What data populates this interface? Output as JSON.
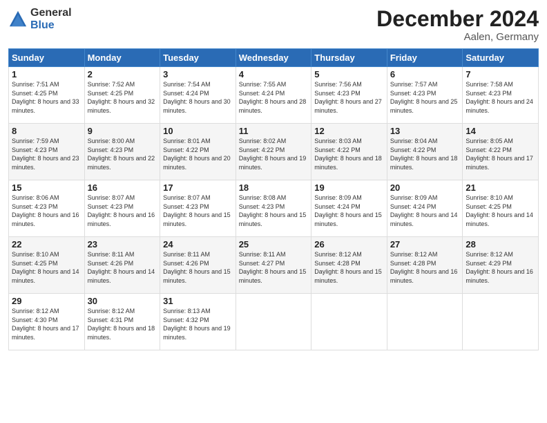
{
  "header": {
    "logo_general": "General",
    "logo_blue": "Blue",
    "month_title": "December 2024",
    "location": "Aalen, Germany"
  },
  "days_of_week": [
    "Sunday",
    "Monday",
    "Tuesday",
    "Wednesday",
    "Thursday",
    "Friday",
    "Saturday"
  ],
  "weeks": [
    [
      {
        "day": "1",
        "sunrise": "Sunrise: 7:51 AM",
        "sunset": "Sunset: 4:25 PM",
        "daylight": "Daylight: 8 hours and 33 minutes."
      },
      {
        "day": "2",
        "sunrise": "Sunrise: 7:52 AM",
        "sunset": "Sunset: 4:25 PM",
        "daylight": "Daylight: 8 hours and 32 minutes."
      },
      {
        "day": "3",
        "sunrise": "Sunrise: 7:54 AM",
        "sunset": "Sunset: 4:24 PM",
        "daylight": "Daylight: 8 hours and 30 minutes."
      },
      {
        "day": "4",
        "sunrise": "Sunrise: 7:55 AM",
        "sunset": "Sunset: 4:24 PM",
        "daylight": "Daylight: 8 hours and 28 minutes."
      },
      {
        "day": "5",
        "sunrise": "Sunrise: 7:56 AM",
        "sunset": "Sunset: 4:23 PM",
        "daylight": "Daylight: 8 hours and 27 minutes."
      },
      {
        "day": "6",
        "sunrise": "Sunrise: 7:57 AM",
        "sunset": "Sunset: 4:23 PM",
        "daylight": "Daylight: 8 hours and 25 minutes."
      },
      {
        "day": "7",
        "sunrise": "Sunrise: 7:58 AM",
        "sunset": "Sunset: 4:23 PM",
        "daylight": "Daylight: 8 hours and 24 minutes."
      }
    ],
    [
      {
        "day": "8",
        "sunrise": "Sunrise: 7:59 AM",
        "sunset": "Sunset: 4:23 PM",
        "daylight": "Daylight: 8 hours and 23 minutes."
      },
      {
        "day": "9",
        "sunrise": "Sunrise: 8:00 AM",
        "sunset": "Sunset: 4:23 PM",
        "daylight": "Daylight: 8 hours and 22 minutes."
      },
      {
        "day": "10",
        "sunrise": "Sunrise: 8:01 AM",
        "sunset": "Sunset: 4:22 PM",
        "daylight": "Daylight: 8 hours and 20 minutes."
      },
      {
        "day": "11",
        "sunrise": "Sunrise: 8:02 AM",
        "sunset": "Sunset: 4:22 PM",
        "daylight": "Daylight: 8 hours and 19 minutes."
      },
      {
        "day": "12",
        "sunrise": "Sunrise: 8:03 AM",
        "sunset": "Sunset: 4:22 PM",
        "daylight": "Daylight: 8 hours and 18 minutes."
      },
      {
        "day": "13",
        "sunrise": "Sunrise: 8:04 AM",
        "sunset": "Sunset: 4:22 PM",
        "daylight": "Daylight: 8 hours and 18 minutes."
      },
      {
        "day": "14",
        "sunrise": "Sunrise: 8:05 AM",
        "sunset": "Sunset: 4:22 PM",
        "daylight": "Daylight: 8 hours and 17 minutes."
      }
    ],
    [
      {
        "day": "15",
        "sunrise": "Sunrise: 8:06 AM",
        "sunset": "Sunset: 4:23 PM",
        "daylight": "Daylight: 8 hours and 16 minutes."
      },
      {
        "day": "16",
        "sunrise": "Sunrise: 8:07 AM",
        "sunset": "Sunset: 4:23 PM",
        "daylight": "Daylight: 8 hours and 16 minutes."
      },
      {
        "day": "17",
        "sunrise": "Sunrise: 8:07 AM",
        "sunset": "Sunset: 4:23 PM",
        "daylight": "Daylight: 8 hours and 15 minutes."
      },
      {
        "day": "18",
        "sunrise": "Sunrise: 8:08 AM",
        "sunset": "Sunset: 4:23 PM",
        "daylight": "Daylight: 8 hours and 15 minutes."
      },
      {
        "day": "19",
        "sunrise": "Sunrise: 8:09 AM",
        "sunset": "Sunset: 4:24 PM",
        "daylight": "Daylight: 8 hours and 15 minutes."
      },
      {
        "day": "20",
        "sunrise": "Sunrise: 8:09 AM",
        "sunset": "Sunset: 4:24 PM",
        "daylight": "Daylight: 8 hours and 14 minutes."
      },
      {
        "day": "21",
        "sunrise": "Sunrise: 8:10 AM",
        "sunset": "Sunset: 4:25 PM",
        "daylight": "Daylight: 8 hours and 14 minutes."
      }
    ],
    [
      {
        "day": "22",
        "sunrise": "Sunrise: 8:10 AM",
        "sunset": "Sunset: 4:25 PM",
        "daylight": "Daylight: 8 hours and 14 minutes."
      },
      {
        "day": "23",
        "sunrise": "Sunrise: 8:11 AM",
        "sunset": "Sunset: 4:26 PM",
        "daylight": "Daylight: 8 hours and 14 minutes."
      },
      {
        "day": "24",
        "sunrise": "Sunrise: 8:11 AM",
        "sunset": "Sunset: 4:26 PM",
        "daylight": "Daylight: 8 hours and 15 minutes."
      },
      {
        "day": "25",
        "sunrise": "Sunrise: 8:11 AM",
        "sunset": "Sunset: 4:27 PM",
        "daylight": "Daylight: 8 hours and 15 minutes."
      },
      {
        "day": "26",
        "sunrise": "Sunrise: 8:12 AM",
        "sunset": "Sunset: 4:28 PM",
        "daylight": "Daylight: 8 hours and 15 minutes."
      },
      {
        "day": "27",
        "sunrise": "Sunrise: 8:12 AM",
        "sunset": "Sunset: 4:28 PM",
        "daylight": "Daylight: 8 hours and 16 minutes."
      },
      {
        "day": "28",
        "sunrise": "Sunrise: 8:12 AM",
        "sunset": "Sunset: 4:29 PM",
        "daylight": "Daylight: 8 hours and 16 minutes."
      }
    ],
    [
      {
        "day": "29",
        "sunrise": "Sunrise: 8:12 AM",
        "sunset": "Sunset: 4:30 PM",
        "daylight": "Daylight: 8 hours and 17 minutes."
      },
      {
        "day": "30",
        "sunrise": "Sunrise: 8:12 AM",
        "sunset": "Sunset: 4:31 PM",
        "daylight": "Daylight: 8 hours and 18 minutes."
      },
      {
        "day": "31",
        "sunrise": "Sunrise: 8:13 AM",
        "sunset": "Sunset: 4:32 PM",
        "daylight": "Daylight: 8 hours and 19 minutes."
      },
      null,
      null,
      null,
      null
    ]
  ]
}
